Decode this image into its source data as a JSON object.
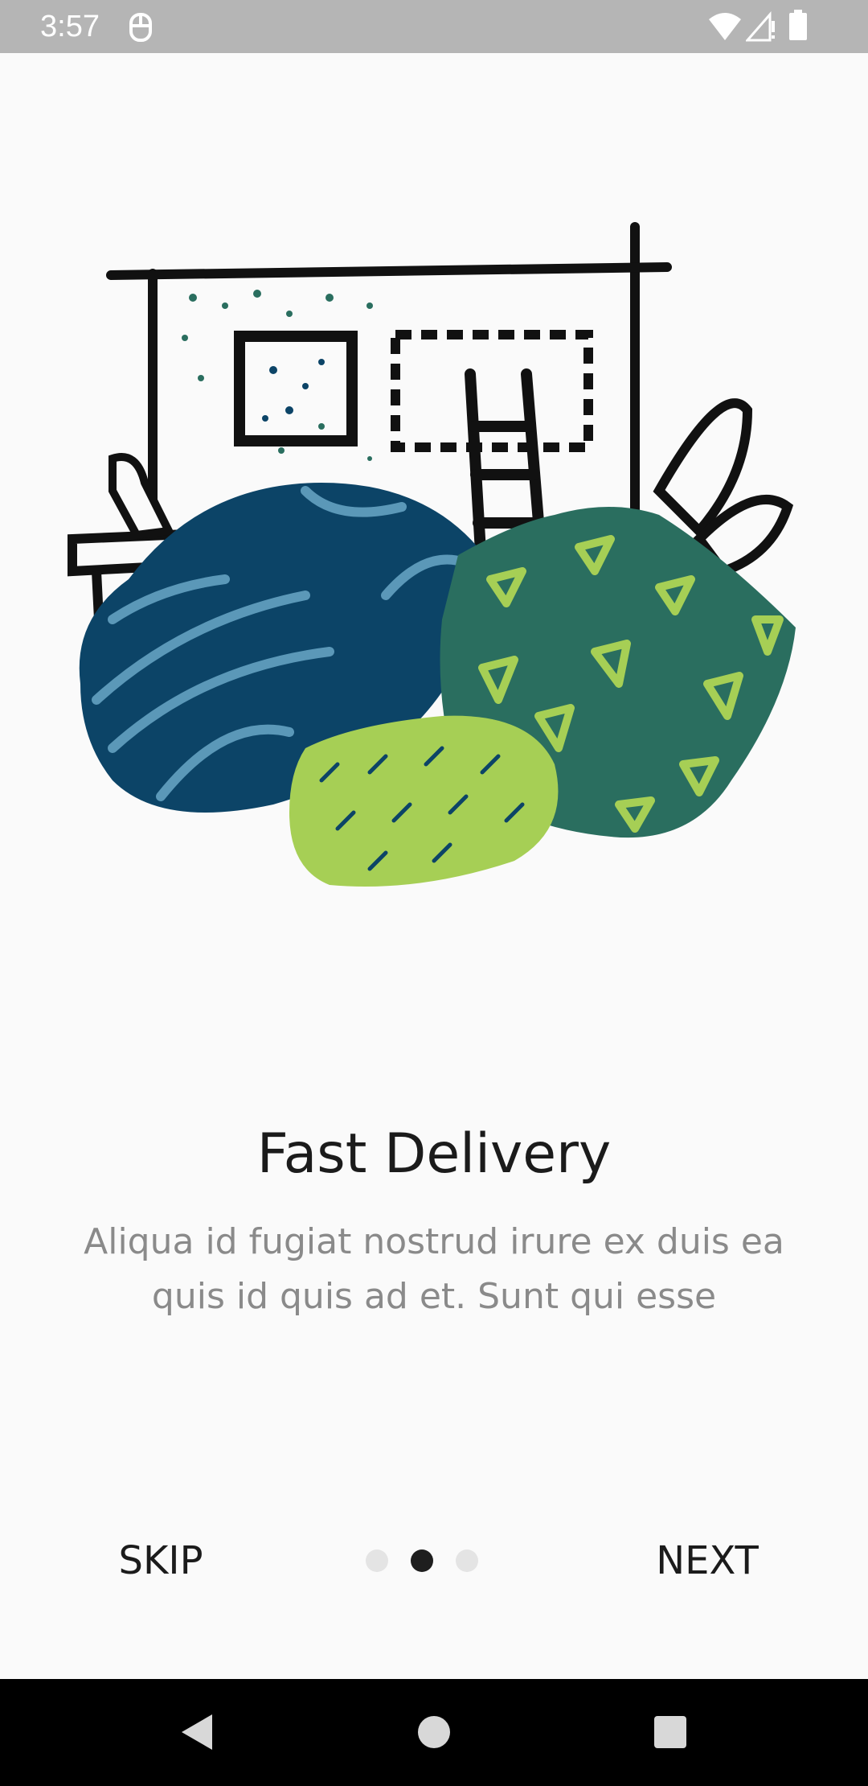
{
  "status_bar": {
    "time": "3:57",
    "icons": [
      "sync-icon",
      "wifi-icon",
      "signal-icon",
      "battery-icon"
    ]
  },
  "illustration": {
    "icon": "interior-furniture-illustration",
    "colors": {
      "navy": "#0c4467",
      "light_blue": "#5b98b8",
      "dark_green": "#2a6e5f",
      "lime": "#a6cf55",
      "ink": "#111111"
    }
  },
  "onboarding": {
    "title": "Fast Delivery",
    "description": "Aliqua id fugiat nostrud irure ex duis ea quis id quis ad et. Sunt qui esse"
  },
  "footer": {
    "skip_label": "SKIP",
    "next_label": "NEXT",
    "page_indicator": {
      "total": 3,
      "current": 2
    }
  },
  "nav_bar": {
    "icons": [
      "back-icon",
      "home-icon",
      "recents-icon"
    ]
  }
}
